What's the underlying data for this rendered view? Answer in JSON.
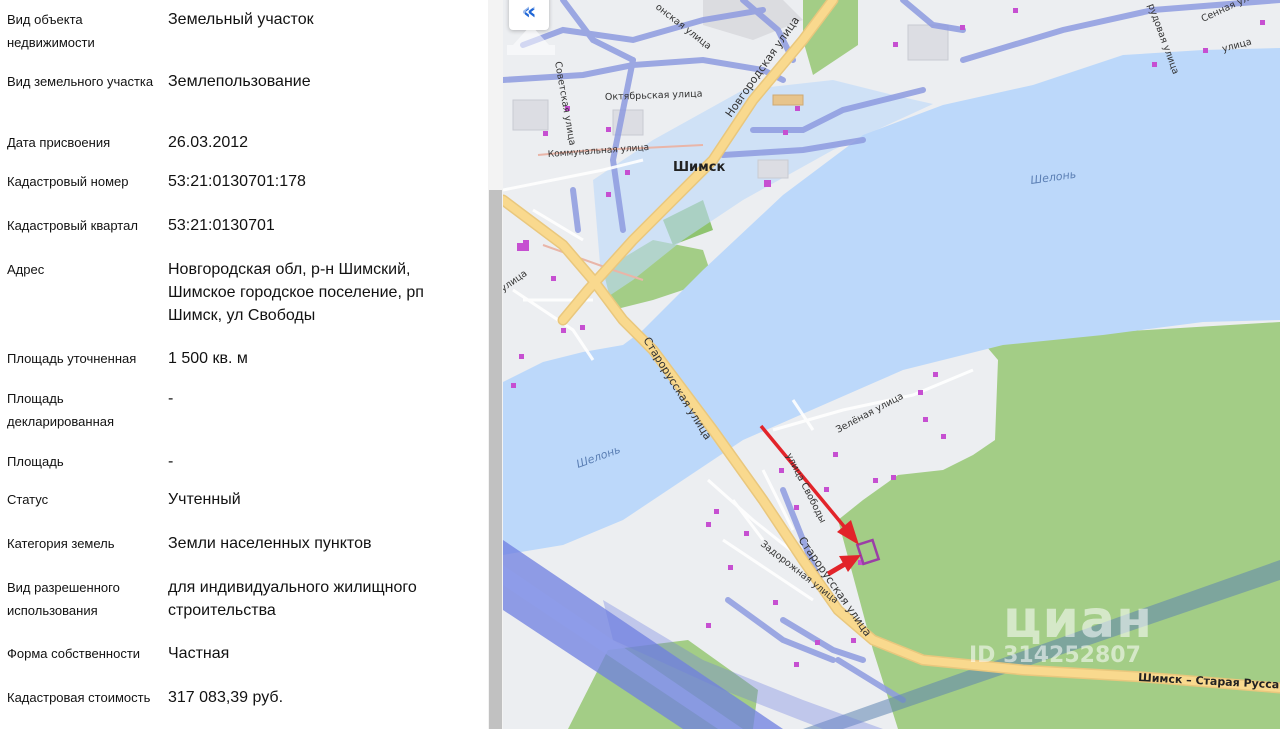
{
  "details": {
    "rows": [
      {
        "label": "Вид объекта недвижимости",
        "value": "Земельный участок"
      },
      {
        "label": "Вид земельного участка",
        "value": "Землепользование"
      },
      {
        "label": "Дата присвоения",
        "value": "26.03.2012"
      },
      {
        "label": "Кадастровый номер",
        "value": "53:21:0130701:178"
      },
      {
        "label": "Кадастровый квартал",
        "value": "53:21:0130701"
      },
      {
        "label": "Адрес",
        "value": "Новгородская обл, р-н Шимский, Шимское городское поселение, рп Шимск, ул Свободы"
      },
      {
        "label": "Площадь уточненная",
        "value": "1 500 кв. м"
      },
      {
        "label": "Площадь декларированная",
        "value": "-"
      },
      {
        "label": "Площадь",
        "value": "-"
      },
      {
        "label": "Статус",
        "value": "Учтенный"
      },
      {
        "label": "Категория земель",
        "value": "Земли населенных пунктов"
      },
      {
        "label": "Вид разрешенного использования",
        "value": "для индивидуального жилищного строительства"
      },
      {
        "label": "Форма собственности",
        "value": "Частная"
      },
      {
        "label": "Кадастровая стоимость",
        "value": "317 083,39 руб."
      }
    ]
  },
  "map": {
    "collapse_button": "«",
    "labels": {
      "shimsk": "Шимск",
      "river_top": "Шелонь",
      "river_bottom": "Шелонь",
      "novgorodskaya": "Новгородская улица",
      "staroruskaya_1": "Старорусская улица",
      "staroruskaya_2": "Старорусская улица",
      "oktyabrskaya": "Октябрьская улица",
      "kommunalnaya": "Коммунальная улица",
      "sovetskaya": "Советская улица",
      "zelenaya": "Зелёная улица",
      "svobody": "улица Свободы",
      "zadorozhnaya": "Задорожная улица",
      "highway": "Шимск – Старая Русса",
      "top_street_1": "онская улица",
      "top_street_2": "Сенная улица",
      "top_street_3": "рудовая улица",
      "top_street_4": "улица",
      "left_street": "улица"
    },
    "watermark": {
      "name": "циан",
      "id": "ID 314252807"
    },
    "colors": {
      "water": "#bcd8fa",
      "forest": "#a3cd86",
      "road": "#f9d98e",
      "marker_arrow": "#e2242a",
      "plot": "#9b3fa6"
    }
  }
}
